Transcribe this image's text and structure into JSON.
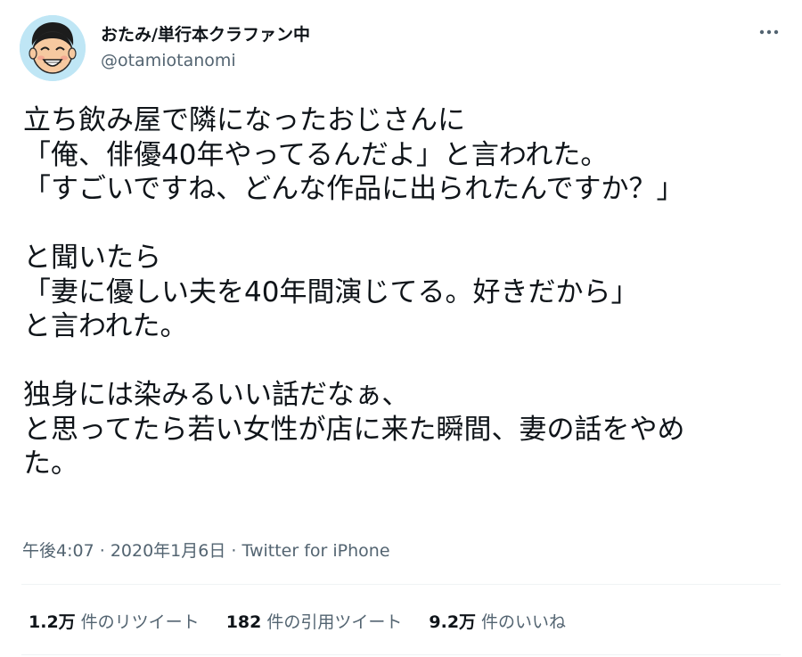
{
  "author": {
    "display_name": "おたみ/単行本クラファン中",
    "handle": "@otamiotanomi",
    "avatar_icon": "cartoon-face-avatar"
  },
  "menu": {
    "icon": "more-horizontal-icon"
  },
  "tweet": {
    "lines": [
      "立ち飲み屋で隣になったおじさんに",
      "「俺、俳優40年やってるんだよ」と言われた。",
      "「すごいですね、どんな作品に出られたんですか？」",
      "",
      "と聞いたら",
      "「妻に優しい夫を40年間演じてる。好きだから」",
      "と言われた。",
      "",
      "独身には染みるいい話だなぁ、",
      "と思ってたら若い女性が店に来た瞬間、妻の話をやめ",
      "た。"
    ]
  },
  "meta": {
    "time": "午後4:07",
    "date": "2020年1月6日",
    "source": "Twitter for iPhone"
  },
  "stats": {
    "retweets_count": "1.2万",
    "retweets_label": "件のリツイート",
    "quotes_count": "182",
    "quotes_label": "件の引用ツイート",
    "likes_count": "9.2万",
    "likes_label": "件のいいね"
  },
  "colors": {
    "text_primary": "#0f1419",
    "text_secondary": "#536471",
    "divider": "#eff3f4",
    "avatar_bg": "#bfe6f5"
  }
}
